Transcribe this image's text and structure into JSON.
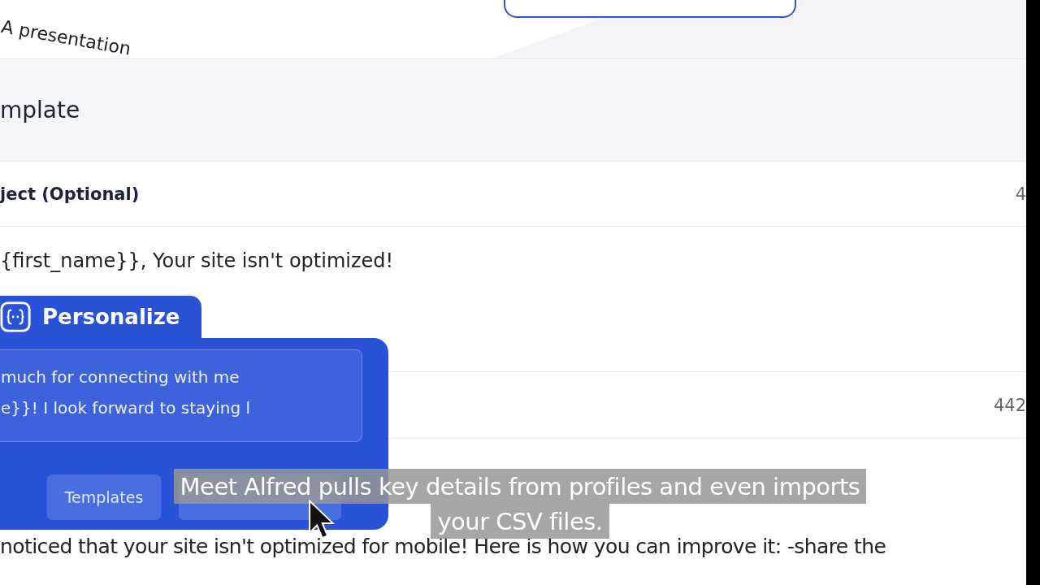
{
  "top": {
    "tilted_text": "A presentation"
  },
  "header": {
    "title": "mplate"
  },
  "subject": {
    "label": "ject (Optional)",
    "counter": "4",
    "value": "{first_name}}, Your site isn't optimized!"
  },
  "body": {
    "counter": "442",
    "value": "noticed that your site isn't optimized for mobile! Here is how you can improve it: -share the"
  },
  "personalize": {
    "title": "Personalize",
    "lines": [
      "much for connecting with me",
      "e}}! I look forward to staying l"
    ],
    "buttons": [
      "Templates"
    ]
  },
  "caption": {
    "lines": [
      "Meet Alfred pulls key details from profiles and even imports",
      "your CSV files."
    ]
  }
}
